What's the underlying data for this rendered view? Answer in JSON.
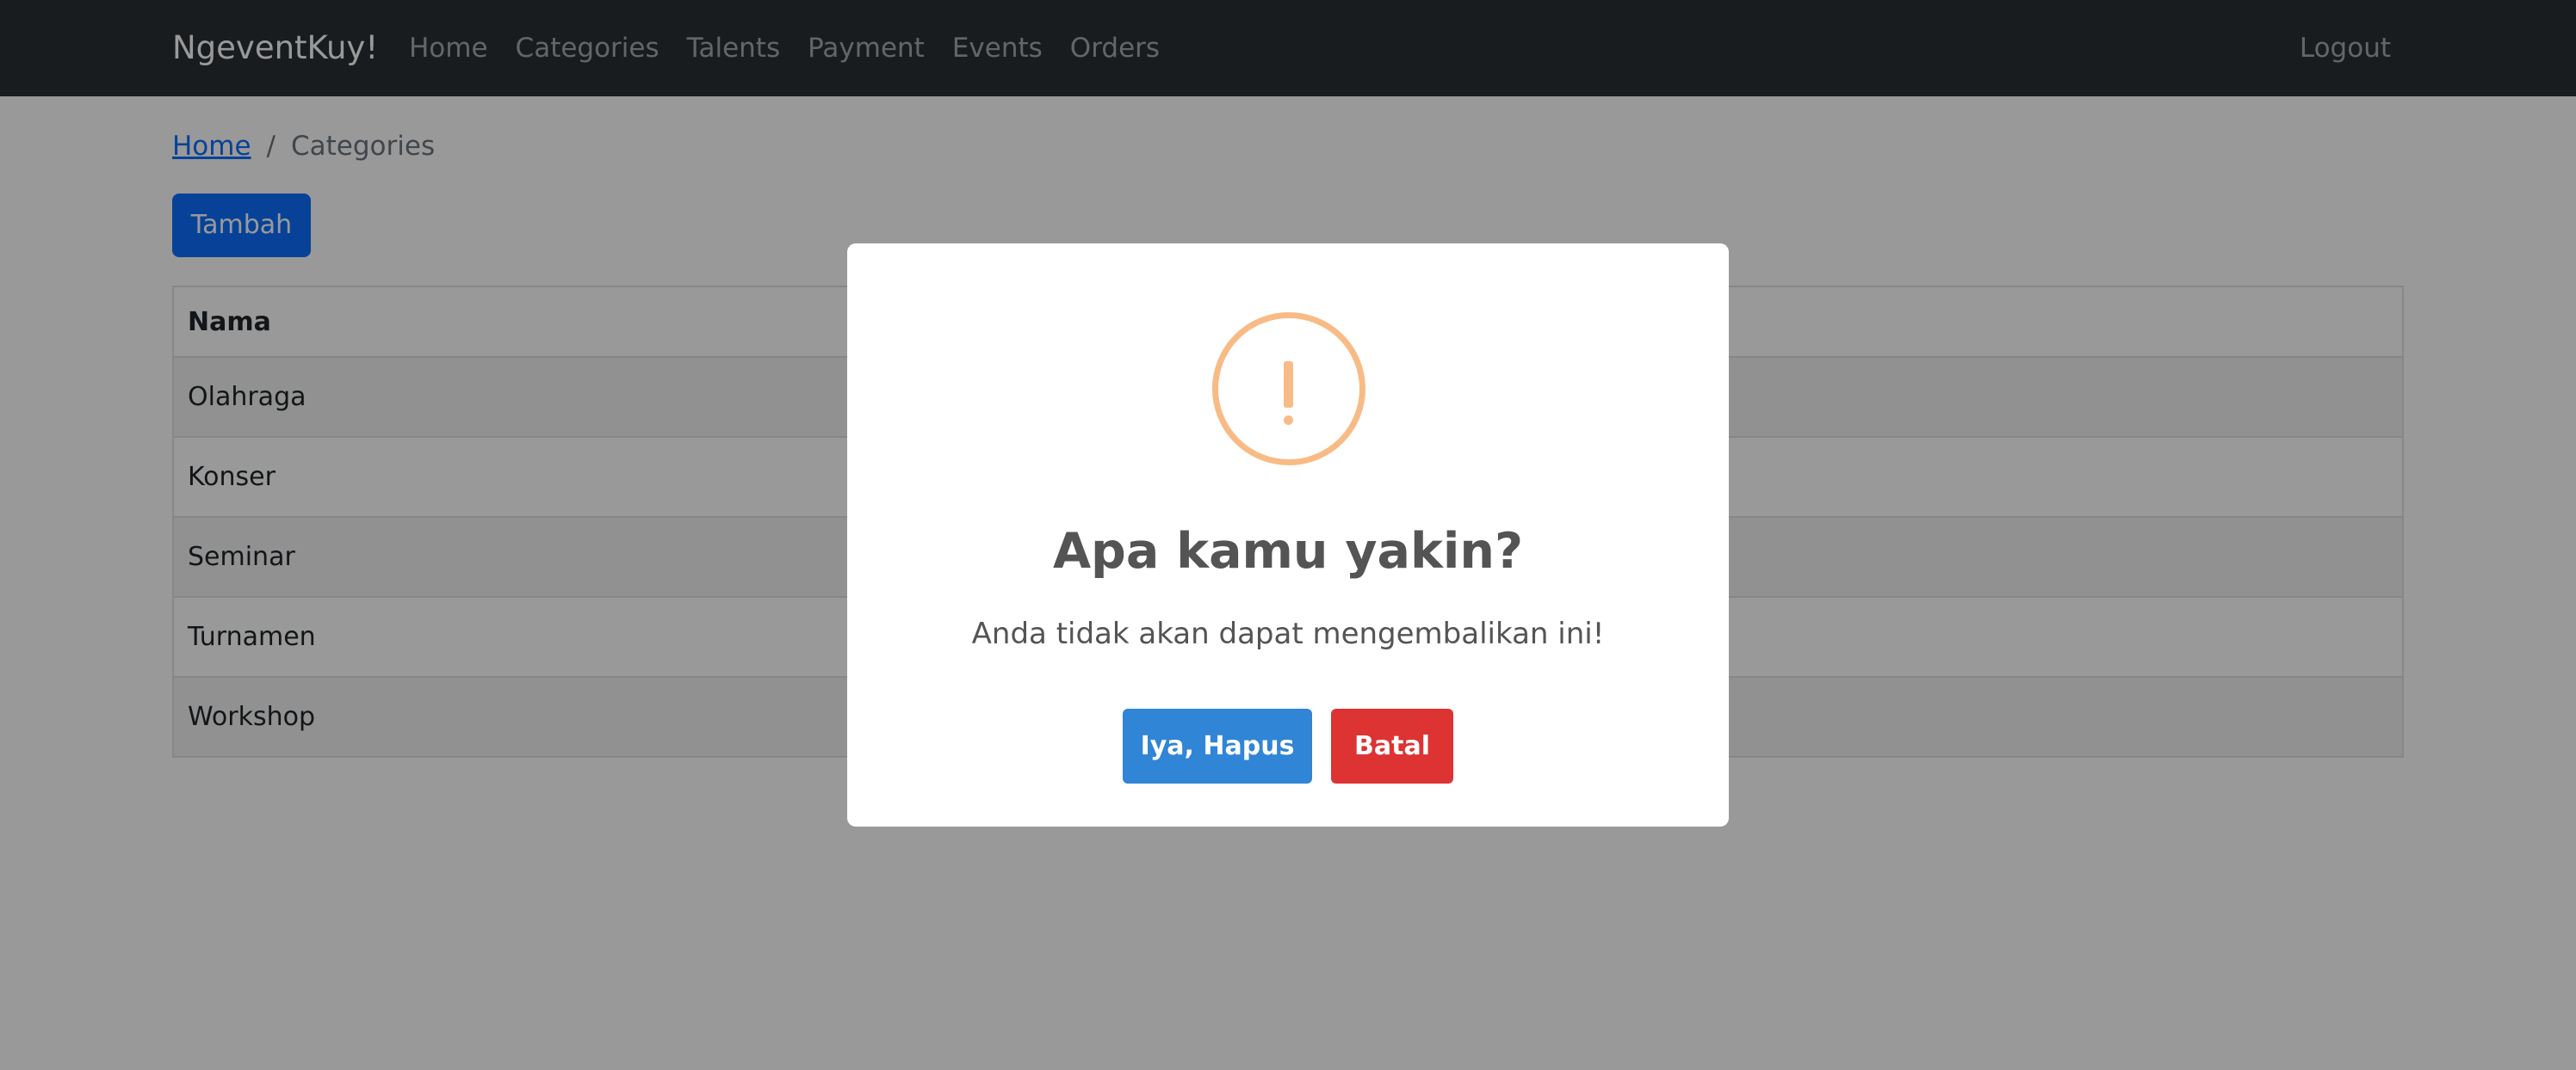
{
  "navbar": {
    "brand": "NgeventKuy!",
    "links": [
      "Home",
      "Categories",
      "Talents",
      "Payment",
      "Events",
      "Orders"
    ],
    "logout": "Logout"
  },
  "breadcrumb": {
    "home": "Home",
    "separator": "/",
    "current": "Categories"
  },
  "toolbar": {
    "add_label": "Tambah"
  },
  "table": {
    "header": "Nama",
    "rows": [
      "Olahraga",
      "Konser",
      "Seminar",
      "Turnamen",
      "Workshop"
    ]
  },
  "dialog": {
    "icon": "warning-icon",
    "icon_color": "#f8bb86",
    "title": "Apa kamu yakin?",
    "text": "Anda tidak akan dapat mengembalikan ini!",
    "confirm_label": "Iya, Hapus",
    "confirm_color": "#3085d6",
    "cancel_label": "Batal",
    "cancel_color": "#dd3333"
  },
  "colors": {
    "navbar_bg": "#2b3035",
    "primary": "#0d6efd",
    "overlay": "rgba(0,0,0,0.4)"
  }
}
